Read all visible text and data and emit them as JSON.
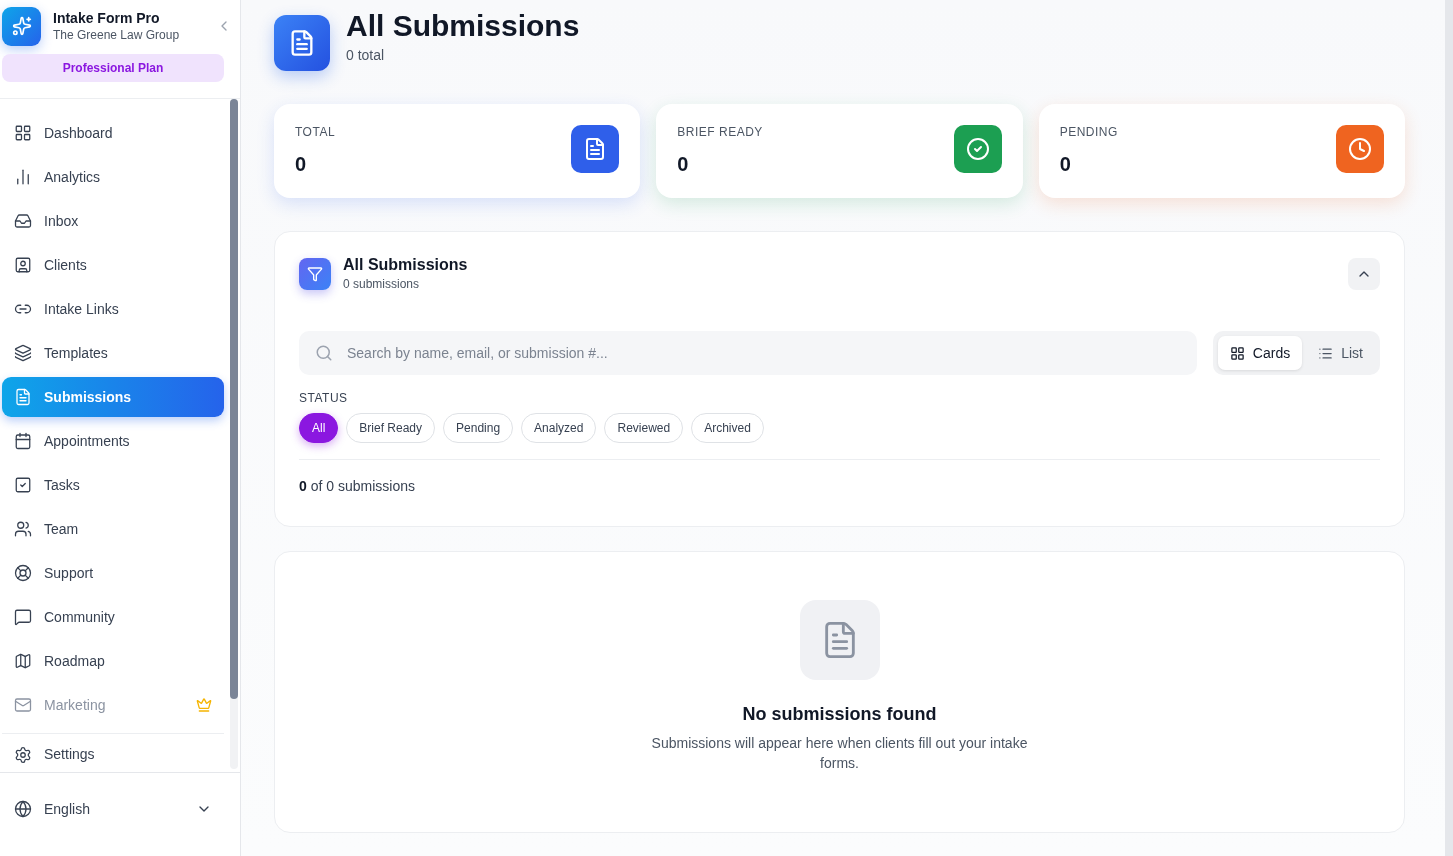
{
  "sidebar": {
    "app_name": "Intake Form Pro",
    "org_name": "The Greene Law Group",
    "plan": "Professional Plan",
    "items": [
      {
        "kind": "dashboard",
        "label": "Dashboard",
        "selected": false,
        "disabled": false,
        "premium": false
      },
      {
        "kind": "analytics",
        "label": "Analytics",
        "selected": false,
        "disabled": false,
        "premium": false
      },
      {
        "kind": "inbox",
        "label": "Inbox",
        "selected": false,
        "disabled": false,
        "premium": false
      },
      {
        "kind": "clients",
        "label": "Clients",
        "selected": false,
        "disabled": false,
        "premium": false
      },
      {
        "kind": "links",
        "label": "Intake Links",
        "selected": false,
        "disabled": false,
        "premium": false
      },
      {
        "kind": "templates",
        "label": "Templates",
        "selected": false,
        "disabled": false,
        "premium": false
      },
      {
        "kind": "submissions",
        "label": "Submissions",
        "selected": true,
        "disabled": false,
        "premium": false
      },
      {
        "kind": "appointments",
        "label": "Appointments",
        "selected": false,
        "disabled": false,
        "premium": false
      },
      {
        "kind": "tasks",
        "label": "Tasks",
        "selected": false,
        "disabled": false,
        "premium": false
      },
      {
        "kind": "team",
        "label": "Team",
        "selected": false,
        "disabled": false,
        "premium": false
      },
      {
        "kind": "support",
        "label": "Support",
        "selected": false,
        "disabled": false,
        "premium": false
      },
      {
        "kind": "community",
        "label": "Community",
        "selected": false,
        "disabled": false,
        "premium": false
      },
      {
        "kind": "roadmap",
        "label": "Roadmap",
        "selected": false,
        "disabled": false,
        "premium": false
      },
      {
        "kind": "marketing",
        "label": "Marketing",
        "selected": false,
        "disabled": true,
        "premium": true
      }
    ],
    "settings_label": "Settings",
    "language": "English"
  },
  "header": {
    "title": "All Submissions",
    "subtitle": "0 total"
  },
  "stats": [
    {
      "kind": "document",
      "label": "TOTAL",
      "value": "0",
      "color": "#2f5fea"
    },
    {
      "kind": "check",
      "label": "BRIEF READY",
      "value": "0",
      "color": "#1c9f52"
    },
    {
      "kind": "clock",
      "label": "PENDING",
      "value": "0",
      "color": "#ef6420"
    }
  ],
  "filter_panel": {
    "title": "All Submissions",
    "subtitle": "0 submissions",
    "search": {
      "placeholder": "Search by name, email, or submission #..."
    },
    "views": [
      {
        "kind": "cards",
        "label": "Cards",
        "selected": true
      },
      {
        "kind": "list",
        "label": "List",
        "selected": false
      }
    ],
    "status_label": "STATUS",
    "chips": [
      {
        "label": "All",
        "selected": true
      },
      {
        "label": "Brief Ready",
        "selected": false
      },
      {
        "label": "Pending",
        "selected": false
      },
      {
        "label": "Analyzed",
        "selected": false
      },
      {
        "label": "Reviewed",
        "selected": false
      },
      {
        "label": "Archived",
        "selected": false
      }
    ],
    "count": "**0** of 0 submissions"
  },
  "empty_state": {
    "title": "No submissions found",
    "message": "Submissions will appear here when clients fill out your intake forms."
  }
}
